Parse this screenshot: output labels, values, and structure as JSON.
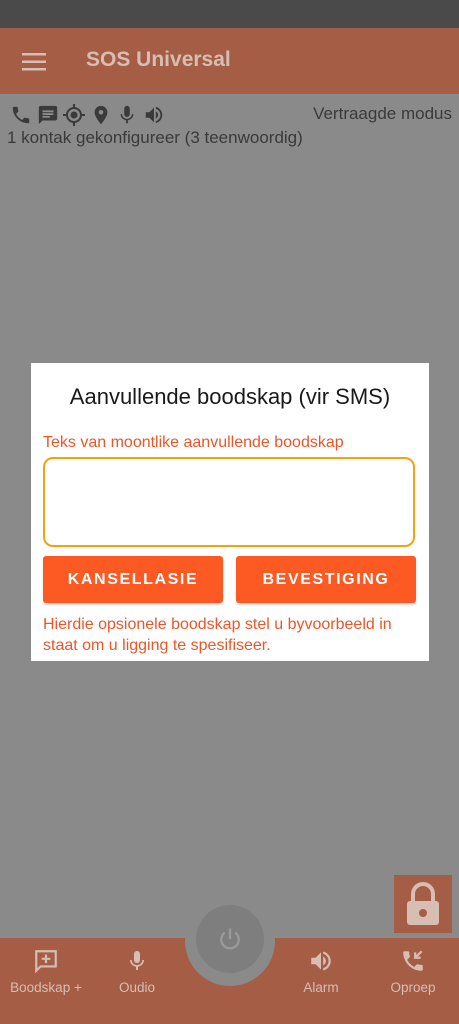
{
  "app": {
    "title": "SOS Universal"
  },
  "status": {
    "mode": "Vertraagde modus",
    "contacts": "1 kontak gekonfigureer (3 teenwoordig)",
    "icons": [
      "phone-icon",
      "sms-icon",
      "gps-icon",
      "location-pin-icon",
      "microphone-icon",
      "speaker-icon"
    ]
  },
  "dialog": {
    "title": "Aanvullende boodskap (vir SMS)",
    "field_label": "Teks van moontlike aanvullende boodskap",
    "field_value": "",
    "cancel_label": "KANSELLASIE",
    "confirm_label": "BEVESTIGING",
    "hint": "Hierdie opsionele boodskap stel u byvoorbeeld in staat om u ligging te spesifiseer."
  },
  "bottom_nav": {
    "items": [
      {
        "label": "Boodskap +",
        "icon": "add-message-icon"
      },
      {
        "label": "Oudio",
        "icon": "microphone-icon"
      },
      {
        "label": "Alarm",
        "icon": "speaker-icon"
      },
      {
        "label": "Oproep",
        "icon": "outgoing-call-icon"
      }
    ],
    "center": {
      "icon": "power-icon"
    }
  },
  "lock": {
    "icon": "lock-icon"
  },
  "colors": {
    "brand": "#a55e45",
    "accent": "#fd5a23",
    "focus": "#f2a30f",
    "overlay": "#8a8a8a"
  }
}
